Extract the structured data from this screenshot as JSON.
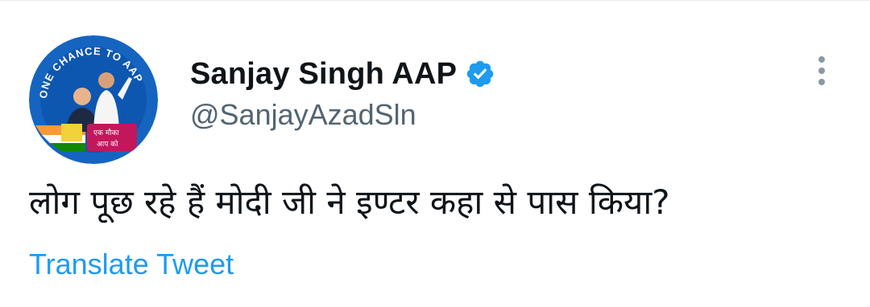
{
  "author": {
    "display_name": "Sanjay Singh AAP",
    "handle": "@SanjayAzadSln",
    "verified": true,
    "avatar": {
      "ring_text": "ONE CHANCE TO AAP",
      "banner_line1": "एक मौका",
      "banner_line2": "आप को"
    }
  },
  "tweet": {
    "text": "लोग पूछ रहे हैं मोदी जी ने इण्टर कहा से पास किया?"
  },
  "actions": {
    "translate_label": "Translate Tweet",
    "more_icon": "more-options-icon"
  },
  "colors": {
    "text": "#0f1419",
    "secondary": "#536471",
    "link": "#1d9bf0",
    "verified": "#1d9bf0"
  }
}
